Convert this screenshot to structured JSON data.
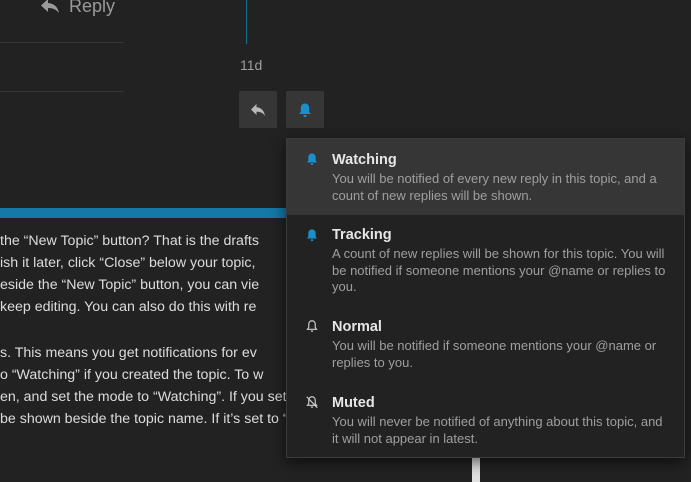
{
  "post": {
    "reply_label": "Reply",
    "time_ago": "11d"
  },
  "colors": {
    "accent": "#1478a8",
    "background": "#222222",
    "button_bg": "#363636"
  },
  "body_lines": [
    "the “New Topic” button? That is the drafts",
    "ish it later, click “Close” below your topic,",
    "eside the “New Topic” button, you can vie",
    "keep editing. You can also do this with re",
    "s. This means you get notifications for ev",
    "o “Watching” if you created the topic. To w",
    "en, and set the mode to “Watching”. If you set the topic to",
    "be shown beside the topic name. If it’s set to “Normal”, then you"
  ],
  "notification_menu": [
    {
      "icon": "bell-icon",
      "title": "Watching",
      "description": "You will be notified of every new reply in this topic, and a count of new replies will be shown.",
      "selected": true
    },
    {
      "icon": "bell-icon",
      "title": "Tracking",
      "description": "A count of new replies will be shown for this topic. You will be notified if someone mentions your @name or replies to you.",
      "selected": false
    },
    {
      "icon": "bell-outline-icon",
      "title": "Normal",
      "description": "You will be notified if someone mentions your @name or replies to you.",
      "selected": false
    },
    {
      "icon": "bell-slash-icon",
      "title": "Muted",
      "description": "You will never be notified of anything about this topic, and it will not appear in latest.",
      "selected": false
    }
  ]
}
